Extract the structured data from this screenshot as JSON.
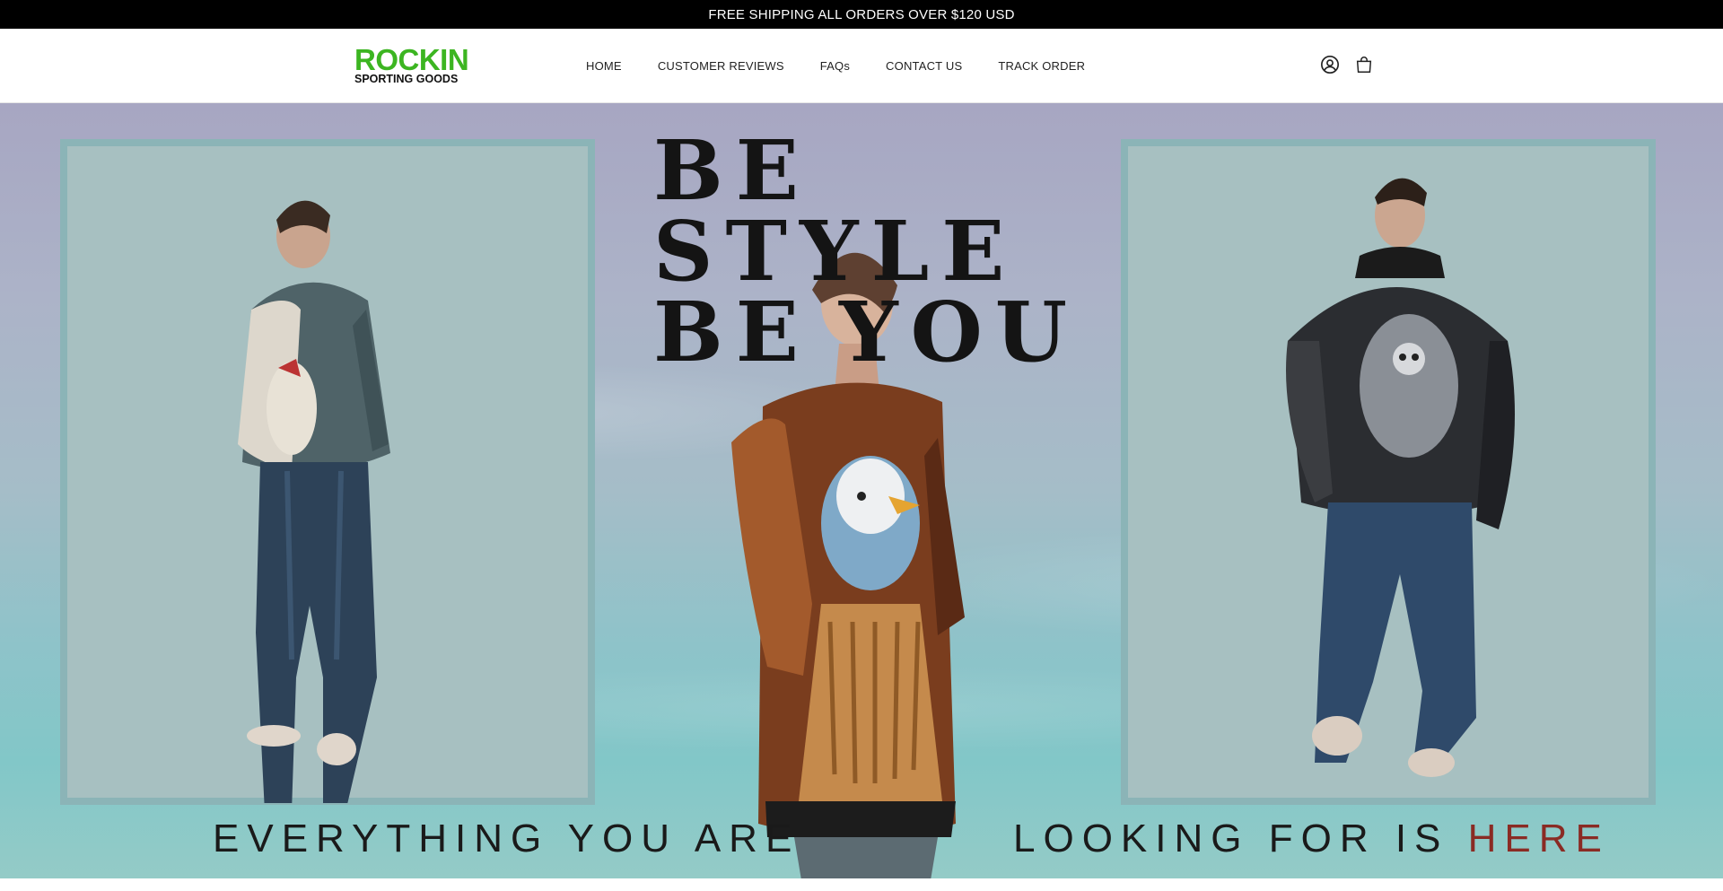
{
  "announcement": {
    "text": "FREE SHIPPING ALL ORDERS OVER $120 USD"
  },
  "header": {
    "logo": {
      "line1": "ROCKIN",
      "line2": "SPORTING GOODS",
      "brand_color": "#3cb521"
    },
    "nav": [
      {
        "label": "HOME"
      },
      {
        "label": "CUSTOMER REVIEWS"
      },
      {
        "label": "FAQs"
      },
      {
        "label": "CONTACT US"
      },
      {
        "label": "TRACK ORDER"
      }
    ],
    "icons": [
      "account-icon",
      "cart-icon"
    ]
  },
  "hero": {
    "headline_line1": "BE STYLE",
    "headline_line2_a": "BE",
    "headline_line2_b": "YOU",
    "tagline_left": "EVERYTHING YOU ARE",
    "tagline_right_main": "LOOKING FOR IS",
    "tagline_right_accent": "HERE",
    "accent_color": "#8a2b24"
  }
}
